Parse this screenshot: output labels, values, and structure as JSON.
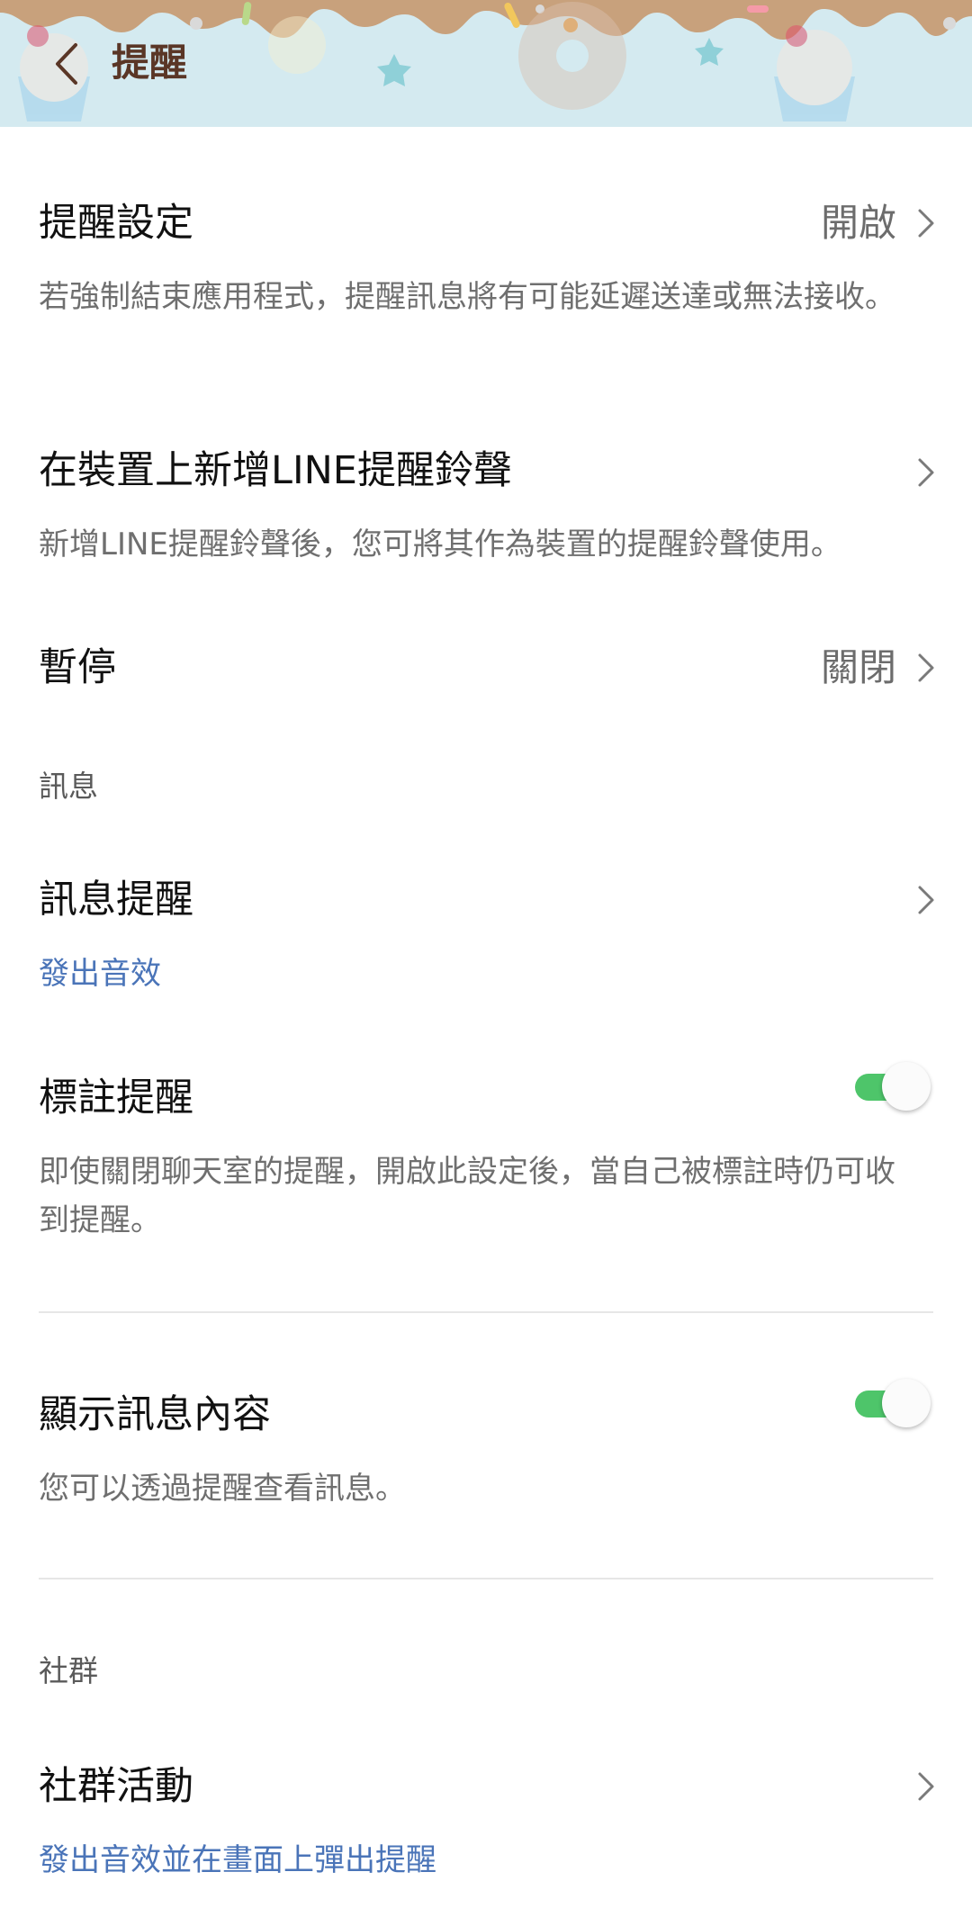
{
  "header": {
    "title": "提醒"
  },
  "notification_settings": {
    "title": "提醒設定",
    "value": "開啟",
    "description": "若強制結束應用程式，提醒訊息將有可能延遲送達或無法接收。"
  },
  "add_ringtone": {
    "title": "在裝置上新增LINE提醒鈴聲",
    "description": "新增LINE提醒鈴聲後，您可將其作為裝置的提醒鈴聲使用。"
  },
  "pause": {
    "title": "暫停",
    "value": "關閉"
  },
  "messages_section": {
    "label": "訊息"
  },
  "message_notifications": {
    "title": "訊息提醒",
    "subtitle": "發出音效"
  },
  "mention_notifications": {
    "title": "標註提醒",
    "description": "即使關閉聊天室的提醒，開啟此設定後，當自己被標註時仍可收到提醒。",
    "enabled": true
  },
  "show_message_content": {
    "title": "顯示訊息內容",
    "description": "您可以透過提醒查看訊息。",
    "enabled": true
  },
  "community_section": {
    "label": "社群"
  },
  "community_activity": {
    "title": "社群活動",
    "subtitle": "發出音效並在畫面上彈出提醒"
  },
  "colors": {
    "toggle_on": "#4ec56a",
    "link_blue": "#4a74b8",
    "header_title": "#5a3626",
    "header_bg": "#d4eaf0"
  }
}
